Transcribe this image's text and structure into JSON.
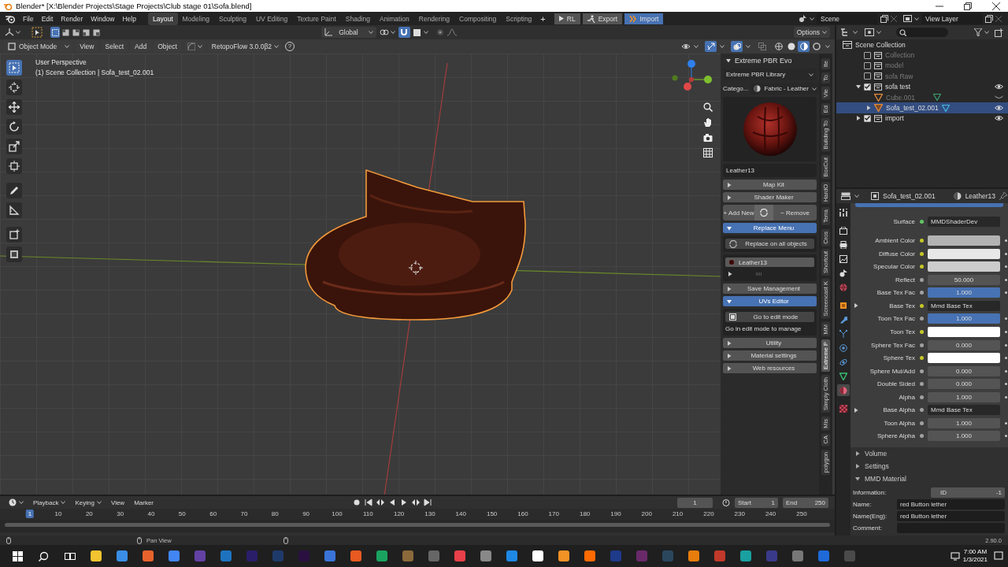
{
  "window": {
    "title": "Blender* [X:\\Blender Projects\\Stage Projects\\Club stage 01\\Sofa.blend]"
  },
  "menu": [
    "File",
    "Edit",
    "Render",
    "Window",
    "Help"
  ],
  "workspaces": [
    {
      "label": "Layout",
      "selected": true
    },
    {
      "label": "Modeling",
      "selected": false
    },
    {
      "label": "Sculpting",
      "selected": false
    },
    {
      "label": "UV Editing",
      "selected": false
    },
    {
      "label": "Texture Paint",
      "selected": false
    },
    {
      "label": "Shading",
      "selected": false
    },
    {
      "label": "Animation",
      "selected": false
    },
    {
      "label": "Rendering",
      "selected": false
    },
    {
      "label": "Compositing",
      "selected": false
    },
    {
      "label": "Scripting",
      "selected": false
    }
  ],
  "add_workspace": "+",
  "addon_buttons": [
    {
      "label": "RL",
      "selected": false
    },
    {
      "label": "Export",
      "selected": false
    },
    {
      "label": "Import",
      "selected": true
    }
  ],
  "scene": "Scene",
  "view_layer": "View Layer",
  "viewport": {
    "orientation": "Global",
    "options": "Options",
    "mode": "Object Mode",
    "menus": [
      "View",
      "Select",
      "Add",
      "Object"
    ],
    "retopoflow": "RetopoFlow 3.0.0β2",
    "help": "?",
    "perspective": "User Perspective",
    "collection_info": "(1) Scene Collection | Sofa_test_02.001",
    "tools": [
      {
        "kind": "select",
        "selected": true
      },
      {
        "kind": "cursor",
        "selected": false
      },
      {
        "kind": "move",
        "selected": false
      },
      {
        "kind": "rotate",
        "selected": false
      },
      {
        "kind": "scale",
        "selected": false
      },
      {
        "kind": "transform",
        "selected": false
      },
      {
        "kind": "annotate",
        "selected": false
      },
      {
        "kind": "measure",
        "selected": false
      },
      {
        "kind": "add",
        "selected": false
      },
      {
        "kind": "extra",
        "selected": false
      }
    ],
    "shading": [
      {
        "selected": false
      },
      {
        "selected": false
      },
      {
        "selected": true
      },
      {
        "selected": false
      }
    ]
  },
  "npanel": {
    "title": "Extreme PBR Evo",
    "library": "Extreme PBR Library",
    "category_label": "Catego...",
    "category": "Fabric - Leather",
    "material_name": "Leather13",
    "items": [
      {
        "kind": "section",
        "label": "Map Kit",
        "expanded": false
      },
      {
        "kind": "section",
        "label": "Shader Maker",
        "expanded": false
      },
      {
        "kind": "actions",
        "add": "+ Add New",
        "remove": "− Remove"
      },
      {
        "kind": "section",
        "label": "Replace Menu",
        "expanded": true
      },
      {
        "kind": "refresh_button",
        "label": "Replace on all objects"
      },
      {
        "kind": "material_list",
        "entries": [
          {
            "label": "Leather13",
            "selected": true
          }
        ]
      },
      {
        "kind": "section",
        "label": "Save Management",
        "expanded": false
      },
      {
        "kind": "section",
        "label": "UVs Editor",
        "expanded": true
      },
      {
        "kind": "edit_button",
        "label": "Go to edit mode"
      },
      {
        "kind": "note",
        "text": "Go in edit mode to manage"
      },
      {
        "kind": "section",
        "label": "Utility",
        "expanded": false
      },
      {
        "kind": "section",
        "label": "Material settings",
        "expanded": false
      },
      {
        "kind": "section",
        "label": "Web resources",
        "expanded": false
      }
    ],
    "tabs": [
      {
        "label": "Ite",
        "selected": false
      },
      {
        "label": "To",
        "selected": false
      },
      {
        "label": "Vie",
        "selected": false
      },
      {
        "label": "Ed",
        "selected": false
      },
      {
        "label": "Building To",
        "selected": false
      },
      {
        "label": "BoxCut",
        "selected": false
      },
      {
        "label": "HardO",
        "selected": false
      },
      {
        "label": "Terra",
        "selected": false
      },
      {
        "label": "Cros",
        "selected": false
      },
      {
        "label": "Shortcut",
        "selected": false
      },
      {
        "label": "Screencast K",
        "selected": false
      },
      {
        "label": "MM",
        "selected": false
      },
      {
        "label": "Extreme P",
        "selected": true
      },
      {
        "label": "Simply Cloth",
        "selected": false
      },
      {
        "label": "Mis",
        "selected": false
      },
      {
        "label": "CA",
        "selected": false
      },
      {
        "label": "polygon",
        "selected": false
      }
    ]
  },
  "outliner": {
    "root": "Scene Collection",
    "children": [
      {
        "label": "Collection",
        "kind": "collection",
        "checked": false
      },
      {
        "label": "model",
        "kind": "collection",
        "checked": false
      },
      {
        "label": "sofa Raw",
        "kind": "collection",
        "checked": false
      },
      {
        "label": "sofa test",
        "kind": "collection",
        "checked": true,
        "expanded": true,
        "visible": true,
        "children": [
          {
            "label": "Cube.001",
            "kind": "object",
            "selected": false,
            "visible": false
          },
          {
            "label": "Sofa_test_02.001",
            "kind": "object",
            "selected": true,
            "visible": true,
            "expanded": false
          }
        ]
      },
      {
        "label": "import",
        "kind": "collection",
        "checked": true,
        "expanded": false,
        "visible": true
      }
    ]
  },
  "properties": {
    "object": "Sofa_test_02.001",
    "material": "Leather13",
    "tabs": [
      {
        "kind": "tool",
        "selected": false
      },
      {
        "kind": "render",
        "selected": false
      },
      {
        "kind": "output",
        "selected": false
      },
      {
        "kind": "view_layer",
        "selected": false
      },
      {
        "kind": "scene",
        "selected": false
      },
      {
        "kind": "world",
        "selected": false
      },
      {
        "kind": "object",
        "selected": false
      },
      {
        "kind": "modifier",
        "selected": false
      },
      {
        "kind": "particles",
        "selected": false
      },
      {
        "kind": "physics",
        "selected": false
      },
      {
        "kind": "constraint",
        "selected": false
      },
      {
        "kind": "data",
        "selected": false
      },
      {
        "kind": "material",
        "selected": true
      },
      {
        "kind": "texture",
        "selected": false
      }
    ],
    "rows": [
      {
        "label": "Surface",
        "kind": "link",
        "color": "#63c763",
        "value": "MMDShaderDev"
      },
      {
        "label": "Ambient Color",
        "kind": "swatch",
        "color": "#c7c729",
        "swatch": {
          "color": "#b3b3b3"
        }
      },
      {
        "label": "Diffuse Color",
        "kind": "swatch",
        "color": "#c7c729",
        "swatch": {
          "color": "#e8e8e8"
        }
      },
      {
        "label": "Specular Color",
        "kind": "swatch",
        "color": "#c7c729",
        "swatch": {
          "color": "#cccccc"
        }
      },
      {
        "label": "Reflect",
        "kind": "number",
        "color": "#a1a1a1",
        "value": "50.000"
      },
      {
        "label": "Base Tex Fac",
        "kind": "factor",
        "color": "#a1a1a1",
        "value": "1.000",
        "level": 1
      },
      {
        "label": "Base Tex",
        "kind": "link",
        "color": "#c7c729",
        "value": "Mmd Base Tex",
        "expanded": false
      },
      {
        "label": "Toon Tex Fac",
        "kind": "factor",
        "color": "#a1a1a1",
        "value": "1.000",
        "level": 1
      },
      {
        "label": "Toon Tex",
        "kind": "swatch",
        "color": "#c7c729",
        "swatch": {
          "color": "#ffffff"
        }
      },
      {
        "label": "Sphere Tex Fac",
        "kind": "number",
        "color": "#a1a1a1",
        "value": "0.000"
      },
      {
        "label": "Sphere Tex",
        "kind": "swatch",
        "color": "#c7c729",
        "swatch": {
          "color": "#ffffff"
        }
      },
      {
        "label": "Sphere Mul/Add",
        "kind": "number",
        "color": "#a1a1a1",
        "value": "0.000"
      },
      {
        "label": "Double Sided",
        "kind": "number",
        "color": "#a1a1a1",
        "value": "0.000"
      },
      {
        "label": "Alpha",
        "kind": "number",
        "color": "#a1a1a1",
        "value": "1.000"
      },
      {
        "label": "Base Alpha",
        "kind": "link",
        "color": "#a1a1a1",
        "value": "Mmd Base Tex",
        "expanded": false
      },
      {
        "label": "Toon Alpha",
        "kind": "number",
        "color": "#a1a1a1",
        "value": "1.000"
      },
      {
        "label": "Sphere Alpha",
        "kind": "number",
        "color": "#a1a1a1",
        "value": "1.000"
      }
    ],
    "panels": [
      {
        "label": "Volume",
        "expanded": false
      },
      {
        "label": "Settings",
        "expanded": false
      },
      {
        "label": "MMD Material",
        "expanded": true
      }
    ],
    "mmd": {
      "information_label": "Information:",
      "id_label": "ID",
      "id_value": "-1",
      "name_label": "Name:",
      "name": "red Button lether",
      "name_eng_label": "Name(Eng):",
      "name_eng": "red Button lether",
      "comment_label": "Comment:"
    }
  },
  "timeline": {
    "menus": [
      "Playback",
      "Keying",
      "View",
      "Marker"
    ],
    "current_frame": "1",
    "start_label": "Start",
    "start": "1",
    "end_label": "End",
    "end": "250",
    "playhead": "1",
    "ruler": [
      "10",
      "20",
      "30",
      "40",
      "50",
      "60",
      "70",
      "80",
      "90",
      "100",
      "110",
      "120",
      "130",
      "140",
      "150",
      "160",
      "170",
      "180",
      "190",
      "200",
      "210",
      "220",
      "230",
      "240",
      "250"
    ]
  },
  "status_bar": {
    "hint": "Pan View",
    "version": "2.90.0"
  },
  "taskbar": {
    "time": "7:00 AM",
    "date": "1/3/2021"
  }
}
